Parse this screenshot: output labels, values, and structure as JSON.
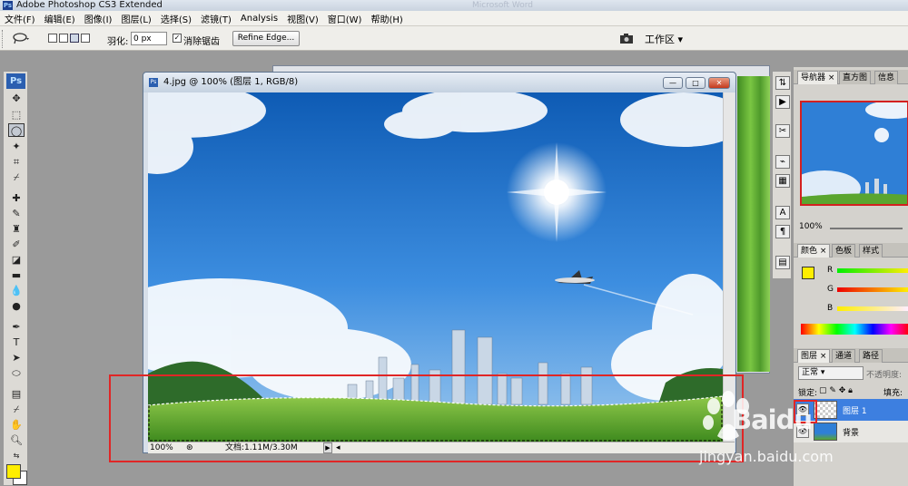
{
  "app": {
    "title": "Adobe Photoshop CS3 Extended",
    "ps_badge": "Ps",
    "background_tabs": [
      "Microsoft Word"
    ]
  },
  "menu": {
    "items": [
      "文件(F)",
      "编辑(E)",
      "图像(I)",
      "图层(L)",
      "选择(S)",
      "滤镜(T)",
      "Analysis",
      "视图(V)",
      "窗口(W)",
      "帮助(H)"
    ]
  },
  "options": {
    "feather_label": "羽化:",
    "feather_value": "0 px",
    "antialias_checked": true,
    "antialias_label": "消除锯齿",
    "refine_edge_label": "Refine Edge...",
    "workspace_label": "工作区 ▾"
  },
  "document": {
    "title": "4.jpg @ 100% (图层 1, RGB/8)",
    "zoom": "100%",
    "doc_info": "文档:1.11M/3.30M",
    "min_label": "—",
    "max_label": "□",
    "close_label": "✕"
  },
  "panels": {
    "navigator_tabs": [
      "导航器",
      "直方图",
      "信息"
    ],
    "navigator_zoom": "100%",
    "color_tabs": [
      "颜色",
      "色板",
      "样式"
    ],
    "channels": [
      "R",
      "G",
      "B"
    ],
    "layer_tabs": [
      "图层",
      "通道",
      "路径"
    ],
    "blend_mode": "正常",
    "opacity_label": "不透明度:",
    "lock_label": "锁定:",
    "fill_label": "填充:",
    "layers": [
      {
        "name": "图层 1",
        "selected": true
      },
      {
        "name": "背景",
        "selected": false
      }
    ]
  },
  "watermark": {
    "brand": "Baidu",
    "url": "jingyan.baidu.com"
  },
  "colors": {
    "foreground": "#ffee00",
    "background": "#ffffff",
    "highlight": "#e02626"
  }
}
